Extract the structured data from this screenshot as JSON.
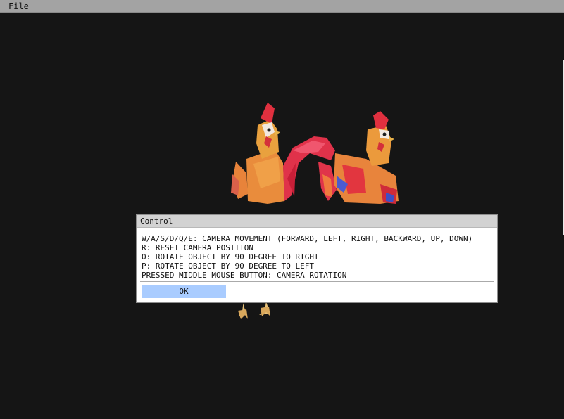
{
  "menubar": {
    "items": [
      {
        "label": "File"
      }
    ]
  },
  "scene": {
    "description_icon": "rooster-3d-models-icon",
    "colors": {
      "background": "#151515",
      "feather_orange": "#e8833a",
      "feather_red": "#e0303f",
      "feather_blue": "#4a5bd0",
      "feet": "#e7b66a"
    }
  },
  "dialog": {
    "title": "Control",
    "lines": [
      "W/A/S/D/Q/E: CAMERA MOVEMENT (FORWARD, LEFT, RIGHT, BACKWARD, UP, DOWN)",
      "R: RESET CAMERA POSITION",
      "O: ROTATE OBJECT BY 90 DEGREE TO RIGHT",
      "P: ROTATE OBJECT BY 90 DEGREE TO LEFT",
      "PRESSED MIDDLE MOUSE BUTTON: CAMERA ROTATION"
    ],
    "ok_label": "OK"
  }
}
